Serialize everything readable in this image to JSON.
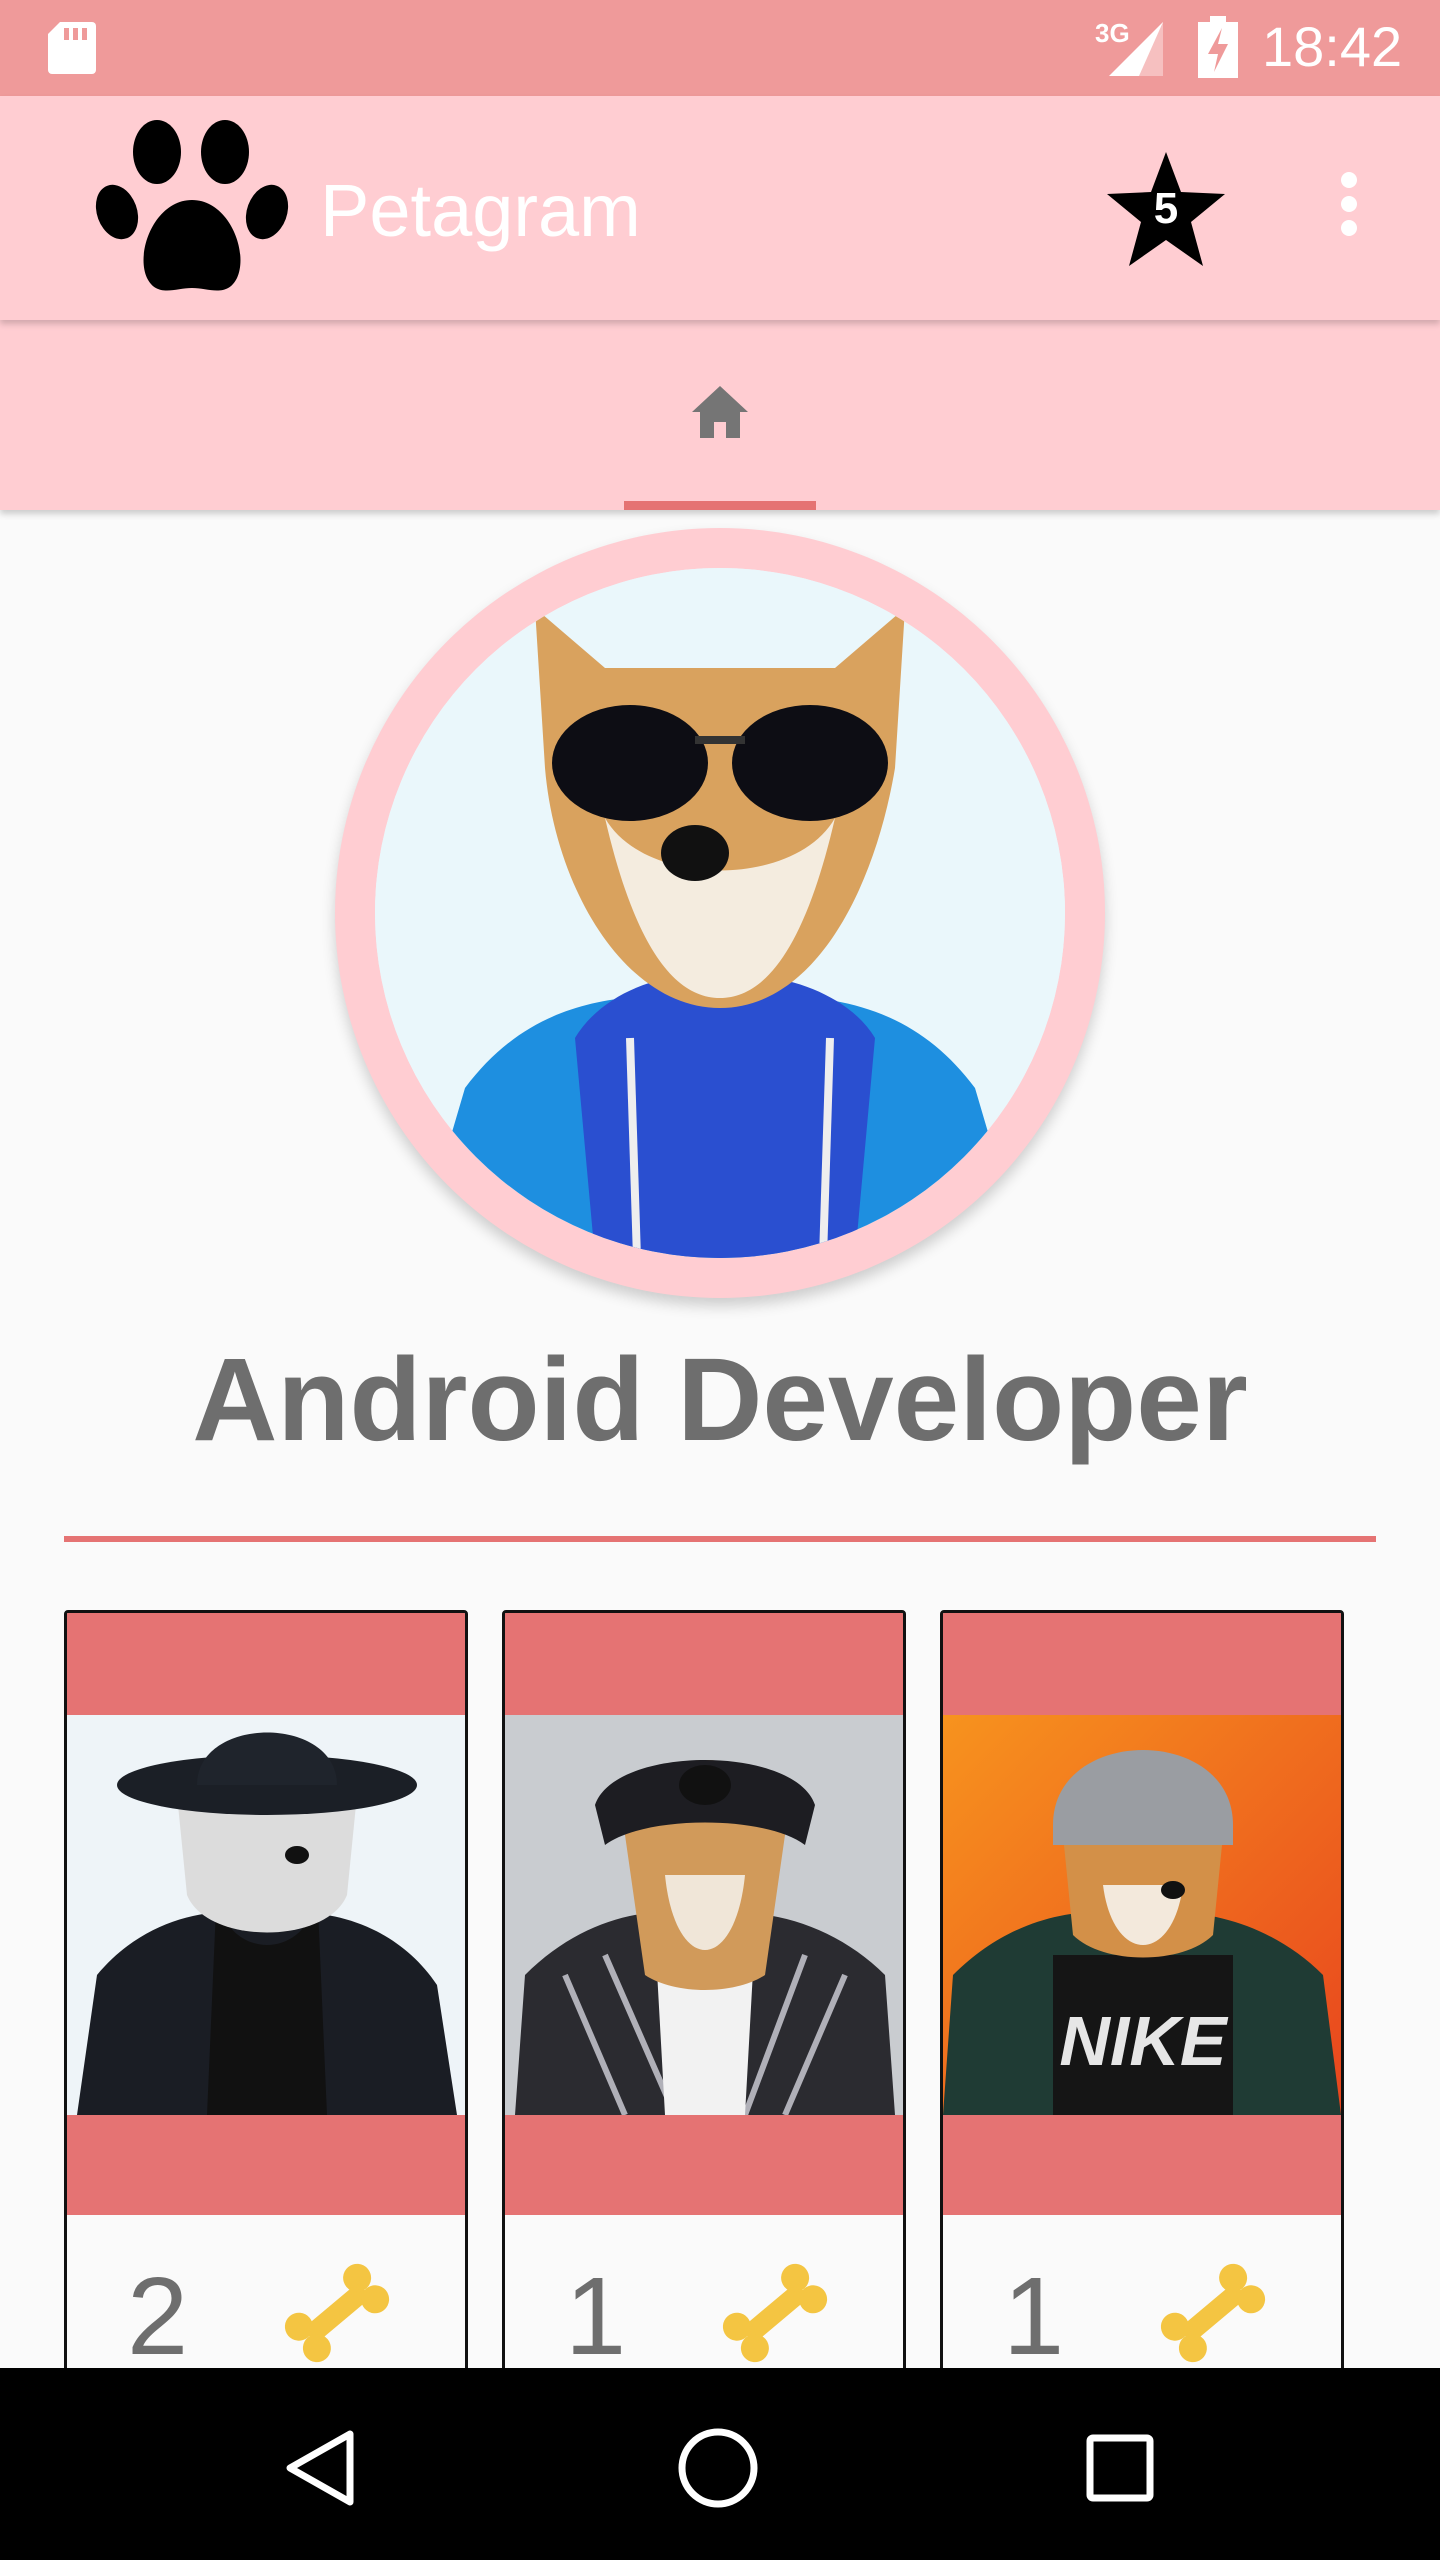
{
  "status_bar": {
    "network": "3G",
    "time": "18:42"
  },
  "app_bar": {
    "title": "Petagram",
    "favorites_count": "5"
  },
  "tabs": [
    {
      "icon": "home-icon",
      "selected": true
    }
  ],
  "profile": {
    "name": "Android Developer"
  },
  "cards": [
    {
      "likes": "2",
      "icon": "bone-icon"
    },
    {
      "likes": "1",
      "icon": "bone-icon"
    },
    {
      "likes": "1",
      "icon": "bone-icon"
    }
  ],
  "colors": {
    "status_bar": "#ef9a9a",
    "primary": "#ffcdd2",
    "accent": "#e57373",
    "name_text": "#6e6e6e"
  }
}
